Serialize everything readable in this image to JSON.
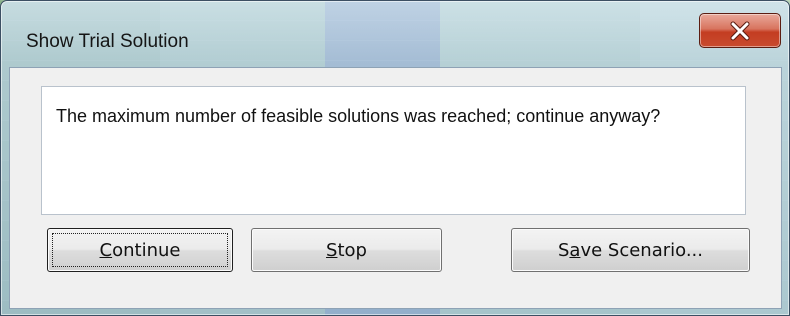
{
  "window": {
    "title": "Show Trial Solution"
  },
  "message": {
    "text": "The maximum number of feasible solutions was reached; continue anyway?"
  },
  "buttons": {
    "continue": {
      "mnemonic": "C",
      "rest": "ontinue"
    },
    "stop": {
      "mnemonic": "S",
      "rest": "top"
    },
    "save": {
      "before": "S",
      "mnemonic": "a",
      "rest": "ve Scenario..."
    }
  },
  "icons": {
    "close": "close-icon"
  },
  "colors": {
    "close_button": "#c84a2e",
    "dialog_bg": "#f0f0f0",
    "message_bg": "#ffffff"
  }
}
